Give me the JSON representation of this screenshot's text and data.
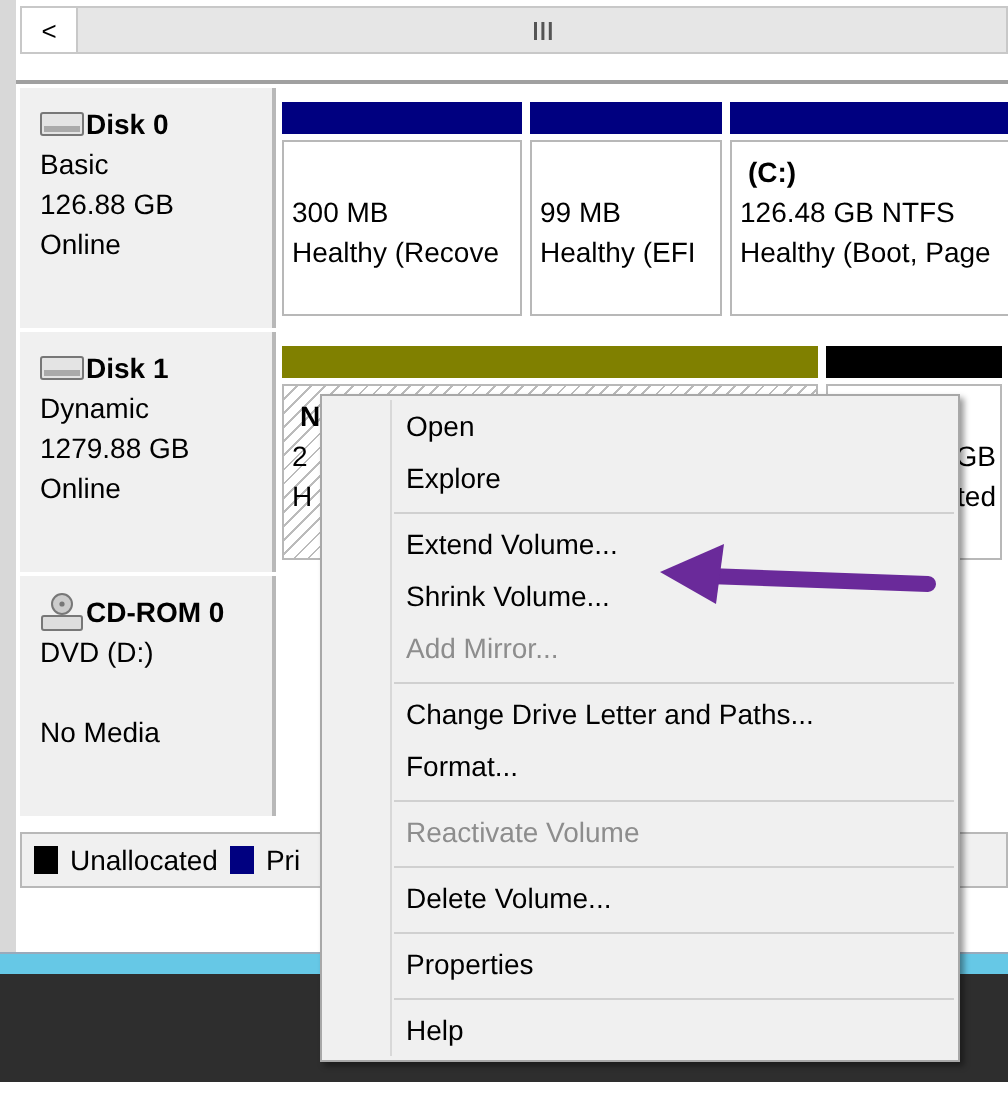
{
  "scrollbar": {
    "left_button": "<"
  },
  "disks": [
    {
      "kind": "disk",
      "name": "Disk 0",
      "lines": [
        "Basic",
        "126.88 GB",
        "Online"
      ],
      "partitions": [
        {
          "color": "#000080",
          "selected": false,
          "lines": [
            "300 MB",
            "Healthy (Recove"
          ]
        },
        {
          "color": "#000080",
          "selected": false,
          "lines": [
            "99 MB",
            "Healthy (EFI"
          ]
        },
        {
          "color": "#000080",
          "selected": false,
          "title": "(C:)",
          "lines": [
            "126.48 GB NTFS",
            "Healthy (Boot, Page"
          ]
        }
      ]
    },
    {
      "kind": "disk",
      "name": "Disk 1",
      "lines": [
        "Dynamic",
        "1279.88 GB",
        "Online"
      ],
      "partitions": [
        {
          "color": "#808000",
          "selected": true,
          "title": "N",
          "lines": [
            "2",
            "H"
          ]
        },
        {
          "color": "#000000",
          "selected": false,
          "lines": [
            "GB",
            "ted"
          ]
        }
      ]
    },
    {
      "kind": "cdrom",
      "name": "CD-ROM 0",
      "lines": [
        "DVD (D:)",
        "No Media"
      ]
    }
  ],
  "legend": [
    {
      "label": "Unallocated",
      "color": "#000000"
    },
    {
      "label": "Pri",
      "color": "#000080"
    }
  ],
  "context_menu": [
    {
      "label": "Open",
      "disabled": false,
      "separator_after": false
    },
    {
      "label": "Explore",
      "disabled": false,
      "separator_after": true
    },
    {
      "label": "Extend Volume...",
      "disabled": false,
      "separator_after": false
    },
    {
      "label": "Shrink Volume...",
      "disabled": false,
      "separator_after": false
    },
    {
      "label": "Add Mirror...",
      "disabled": true,
      "separator_after": true
    },
    {
      "label": "Change Drive Letter and Paths...",
      "disabled": false,
      "separator_after": false
    },
    {
      "label": "Format...",
      "disabled": false,
      "separator_after": true
    },
    {
      "label": "Reactivate Volume",
      "disabled": true,
      "separator_after": true
    },
    {
      "label": "Delete Volume...",
      "disabled": false,
      "separator_after": true
    },
    {
      "label": "Properties",
      "disabled": false,
      "separator_after": true
    },
    {
      "label": "Help",
      "disabled": false,
      "separator_after": false
    }
  ]
}
